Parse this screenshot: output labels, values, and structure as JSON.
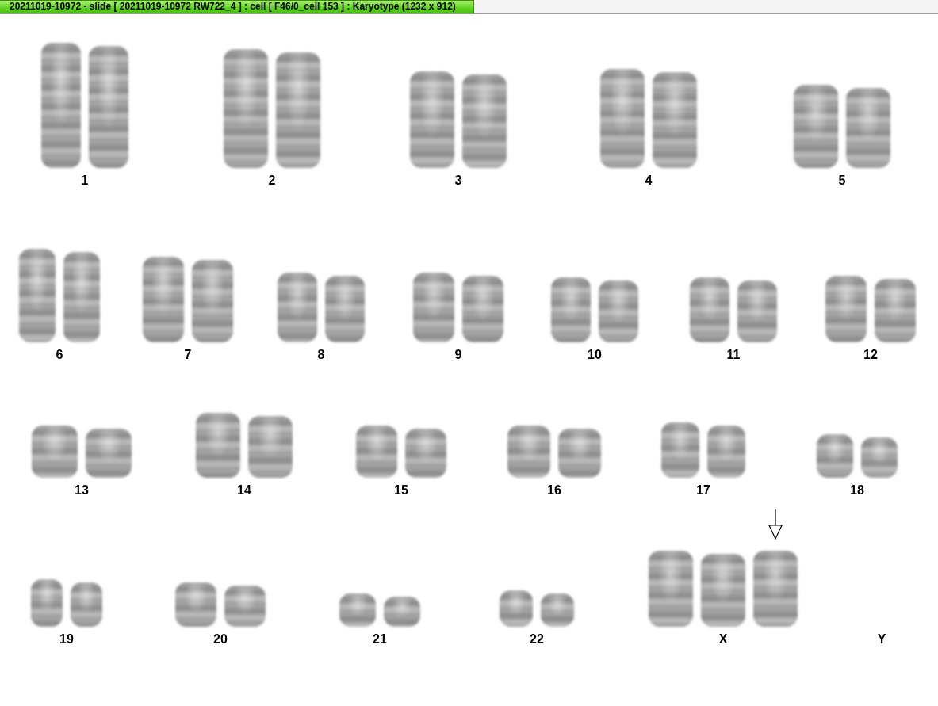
{
  "window": {
    "title": "20211019-10972 - slide [ 20211019-10972 RW722_4 ] : cell [ F46/0_cell 153 ] : Karyotype  (1232 x 912)"
  },
  "groups": [
    {
      "label": "1",
      "homologs": [
        {
          "marked": false
        },
        {
          "marked": false
        }
      ]
    },
    {
      "label": "2",
      "homologs": [
        {
          "marked": false
        },
        {
          "marked": false
        }
      ]
    },
    {
      "label": "3",
      "homologs": [
        {
          "marked": false
        },
        {
          "marked": false
        }
      ]
    },
    {
      "label": "4",
      "homologs": [
        {
          "marked": false
        },
        {
          "marked": false
        }
      ]
    },
    {
      "label": "5",
      "homologs": [
        {
          "marked": false
        },
        {
          "marked": false
        }
      ]
    },
    {
      "label": "6",
      "homologs": [
        {
          "marked": false
        },
        {
          "marked": false
        }
      ]
    },
    {
      "label": "7",
      "homologs": [
        {
          "marked": false
        },
        {
          "marked": false
        }
      ]
    },
    {
      "label": "8",
      "homologs": [
        {
          "marked": false
        },
        {
          "marked": false
        }
      ]
    },
    {
      "label": "9",
      "homologs": [
        {
          "marked": false
        },
        {
          "marked": false
        }
      ]
    },
    {
      "label": "10",
      "homologs": [
        {
          "marked": false
        },
        {
          "marked": false
        }
      ]
    },
    {
      "label": "11",
      "homologs": [
        {
          "marked": false
        },
        {
          "marked": false
        }
      ]
    },
    {
      "label": "12",
      "homologs": [
        {
          "marked": false
        },
        {
          "marked": false
        }
      ]
    },
    {
      "label": "13",
      "homologs": [
        {
          "marked": false
        },
        {
          "marked": false
        }
      ]
    },
    {
      "label": "14",
      "homologs": [
        {
          "marked": false
        },
        {
          "marked": false
        }
      ]
    },
    {
      "label": "15",
      "homologs": [
        {
          "marked": false
        },
        {
          "marked": false
        }
      ]
    },
    {
      "label": "16",
      "homologs": [
        {
          "marked": false
        },
        {
          "marked": false
        }
      ]
    },
    {
      "label": "17",
      "homologs": [
        {
          "marked": false
        },
        {
          "marked": false
        }
      ]
    },
    {
      "label": "18",
      "homologs": [
        {
          "marked": false
        },
        {
          "marked": false
        }
      ]
    },
    {
      "label": "19",
      "homologs": [
        {
          "marked": false
        },
        {
          "marked": false
        }
      ]
    },
    {
      "label": "20",
      "homologs": [
        {
          "marked": false
        },
        {
          "marked": false
        }
      ]
    },
    {
      "label": "21",
      "homologs": [
        {
          "marked": false
        },
        {
          "marked": false
        }
      ]
    },
    {
      "label": "22",
      "homologs": [
        {
          "marked": false
        },
        {
          "marked": false
        }
      ]
    },
    {
      "label": "X",
      "homologs": [
        {
          "marked": false
        },
        {
          "marked": false
        },
        {
          "marked": true
        }
      ]
    },
    {
      "label": "Y"
    }
  ]
}
